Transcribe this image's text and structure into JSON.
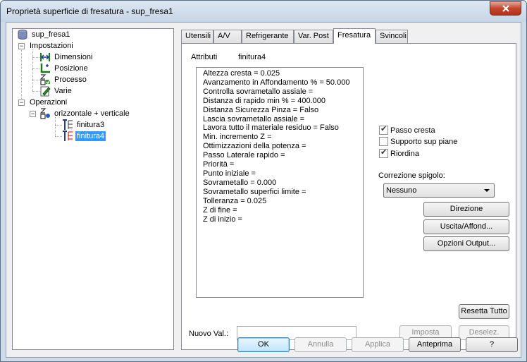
{
  "window": {
    "title": "Proprietà superficie di fresatura - sup_fresa1"
  },
  "tree": {
    "root": "sup_fresa1",
    "settings": "Impostazioni",
    "dimensions": "Dimensioni",
    "position": "Posizione",
    "process": "Processo",
    "misc": "Varie",
    "operations": "Operazioni",
    "group": "orizzontale + verticale",
    "item1": "finitura3",
    "item2": "finitura4"
  },
  "tabs": [
    "Utensili",
    "A/V",
    "Refrigerante",
    "Var. Post",
    "Fresatura",
    "Svincoli"
  ],
  "attributes": {
    "label": "Attributi",
    "value": "finitura4"
  },
  "params": [
    "Altezza cresta = 0.025",
    "Avanzamento in Affondamento % = 50.000",
    "Controlla sovrametallo assiale =",
    "Distanza di rapido min % = 400.000",
    "Distanza Sicurezza Pinza = Falso",
    "Lascia sovrametallo assiale =",
    "Lavora tutto il materiale residuo = Falso",
    "Min. incremento Z =",
    "Ottimizzazioni della potenza =",
    "Passo Laterale rapido =",
    "Priorità =",
    "Punto iniziale =",
    "Sovrametallo = 0.000",
    "Sovrametallo superfici limite =",
    "Tolleranza = 0.025",
    "Z di fine =",
    "Z di inizio ="
  ],
  "options": {
    "passo_cresta": {
      "label": "Passo cresta",
      "checked": true
    },
    "supporto": {
      "label": "Supporto sup piane",
      "checked": false
    },
    "riordina": {
      "label": "Riordina",
      "checked": true
    }
  },
  "corner": {
    "label": "Correzione spigolo:",
    "value": "Nessuno"
  },
  "buttons": {
    "direzione": "Direzione",
    "uscita": "Uscita/Affond...",
    "opzioni": "Opzioni Output...",
    "resetta": "Resetta Tutto",
    "imposta": "Imposta",
    "deselez": "Deselez.",
    "ok": "OK",
    "annulla": "Annulla",
    "applica": "Applica",
    "anteprima": "Anteprima",
    "help": "?"
  },
  "newval": {
    "label": "Nuovo Val.:",
    "value": ""
  },
  "colors": {
    "selection": "#3399ff",
    "titlebar": "#c6d5e6",
    "close": "#c4452e"
  }
}
